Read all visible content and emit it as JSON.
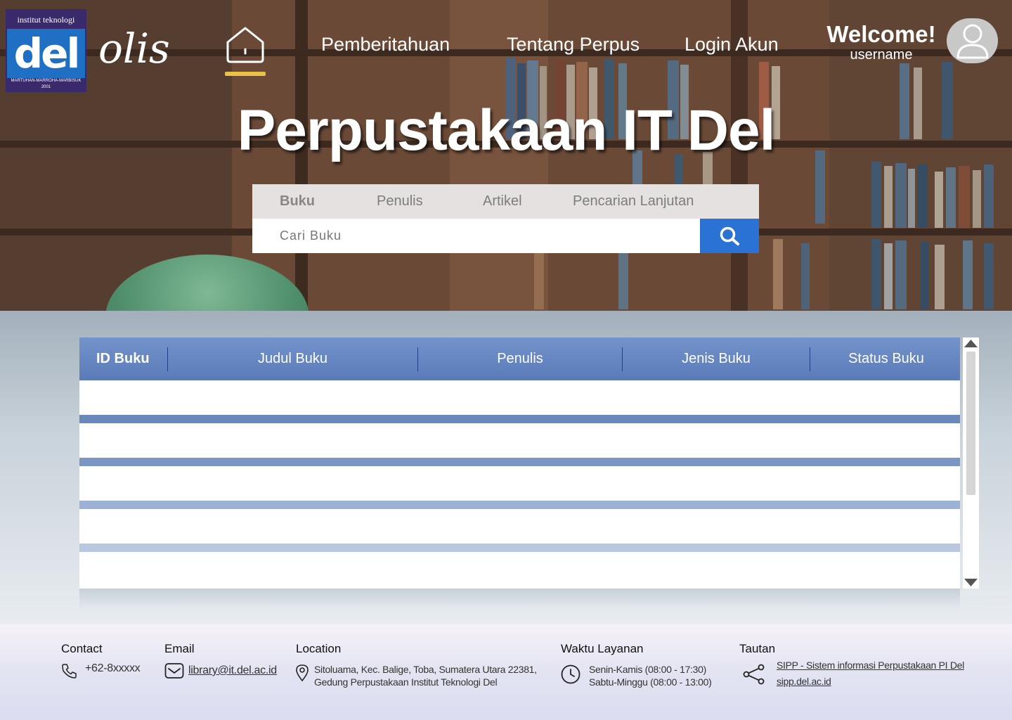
{
  "brand": {
    "logo_top": "institut teknologi",
    "logo_main": "del",
    "logo_motto": "MARTUHAN-MARROHA-MARBISUK",
    "logo_year": "2001",
    "olis": "olis"
  },
  "nav": {
    "items": [
      "Pemberitahuan",
      "Tentang Perpus",
      "Login Akun"
    ]
  },
  "user": {
    "welcome": "Welcome!",
    "username": "username"
  },
  "hero": {
    "title": "Perpustakaan IT Del"
  },
  "search": {
    "tabs": [
      "Buku",
      "Penulis",
      "Artikel",
      "Pencarian Lanjutan"
    ],
    "active_tab": "Buku",
    "placeholder": "Cari Buku"
  },
  "table": {
    "columns": [
      "ID Buku",
      "Judul Buku",
      "Penulis",
      "Jenis Buku",
      "Status Buku"
    ],
    "rows": [
      [],
      [],
      [],
      [],
      []
    ]
  },
  "footer": {
    "contact": {
      "label": "Contact",
      "phone": "+62-8xxxxx"
    },
    "email": {
      "label": "Email",
      "address": "library@it.del.ac.id"
    },
    "location": {
      "label": "Location",
      "line1": "Sitoluama, Kec. Balige, Toba, Sumatera Utara 22381,",
      "line2": "Gedung Perpustakaan Institut Teknologi Del"
    },
    "hours": {
      "label": "Waktu Layanan",
      "line1": "Senin-Kamis (08:00 - 17:30)",
      "line2": "Sabtu-Minggu (08:00 - 13:00)"
    },
    "links": {
      "label": "Tautan",
      "line1": "SIPP - Sistem informasi Perpustakaan PI Del",
      "line2": "sipp.del.ac.id"
    }
  },
  "colors": {
    "search_button": "#2a72d3",
    "table_header": "#6586c2",
    "home_underline": "#e9c24a"
  }
}
